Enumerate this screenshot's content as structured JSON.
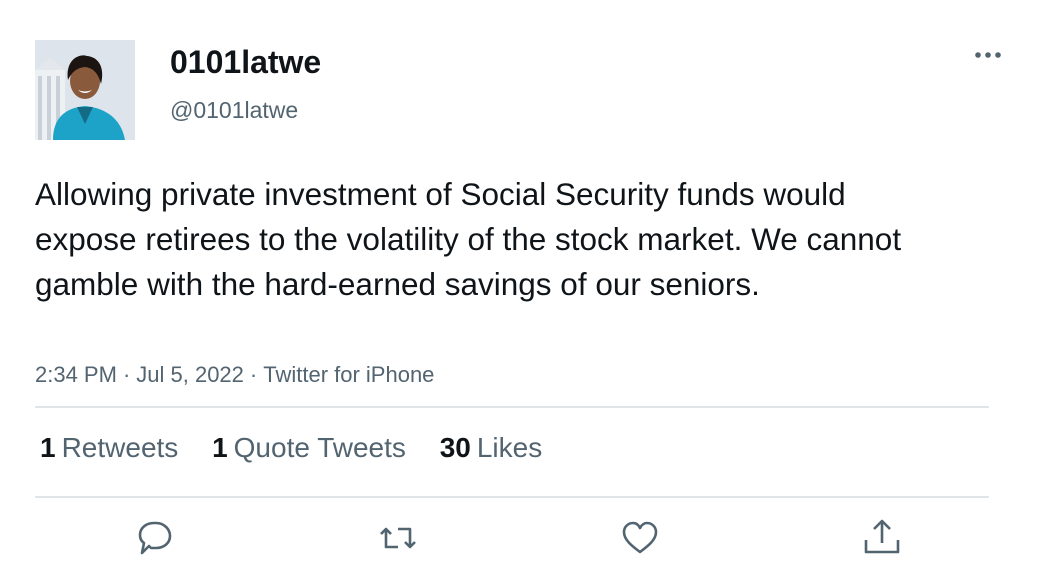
{
  "user": {
    "display_name": "0101latwe",
    "handle": "@0101latwe",
    "avatar_alt": "profile photo"
  },
  "tweet": {
    "text": "Allowing private investment of Social Security funds would expose retirees to the volatility of the stock market. We cannot gamble with the hard-earned savings of our seniors.",
    "time": "2:34 PM",
    "date": "Jul 5, 2022",
    "source": "Twitter for iPhone",
    "separator": "·"
  },
  "stats": {
    "retweets": {
      "count": "1",
      "label": "Retweets"
    },
    "quote_tweets": {
      "count": "1",
      "label": "Quote Tweets"
    },
    "likes": {
      "count": "30",
      "label": "Likes"
    }
  },
  "actions": [
    {
      "icon": "reply-icon"
    },
    {
      "icon": "retweet-icon"
    },
    {
      "icon": "like-icon"
    },
    {
      "icon": "share-icon"
    }
  ],
  "colors": {
    "text_primary": "#0f1419",
    "text_secondary": "#536471",
    "divider": "#e1e4e7",
    "jacket": "#1ea3c8"
  }
}
